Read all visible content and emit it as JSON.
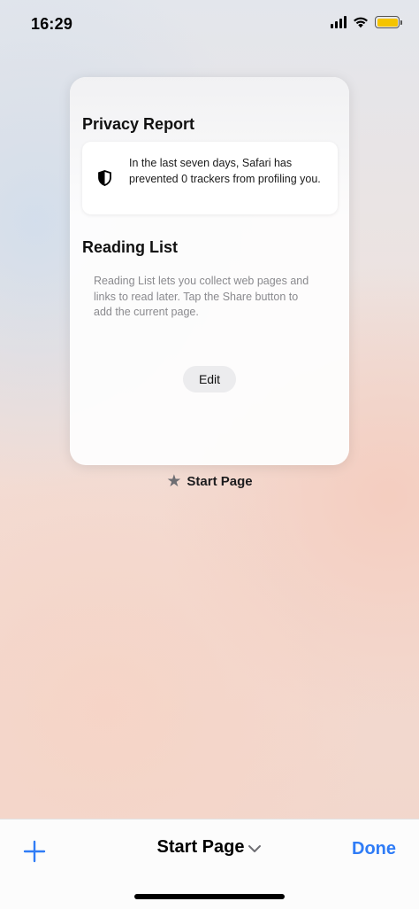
{
  "status_bar": {
    "time": "16:29",
    "icons": [
      "signal-icon",
      "wifi-icon",
      "battery-icon"
    ],
    "battery_color": "#f5c400"
  },
  "tab": {
    "privacy_title": "Privacy Report",
    "privacy_text": "In the last seven days, Safari has prevented 0 trackers from profiling you.",
    "reading_title": "Reading List",
    "reading_text": "Reading List lets you collect web pages and links to read later. Tap the Share button to add the current page.",
    "edit_label": "Edit",
    "label": "Start Page",
    "label_icon": "star-icon"
  },
  "toolbar": {
    "add_icon": "plus-icon",
    "title": "Start Page",
    "title_icon": "chevron-down-icon",
    "done_label": "Done",
    "accent_color": "#2f7cf6"
  }
}
